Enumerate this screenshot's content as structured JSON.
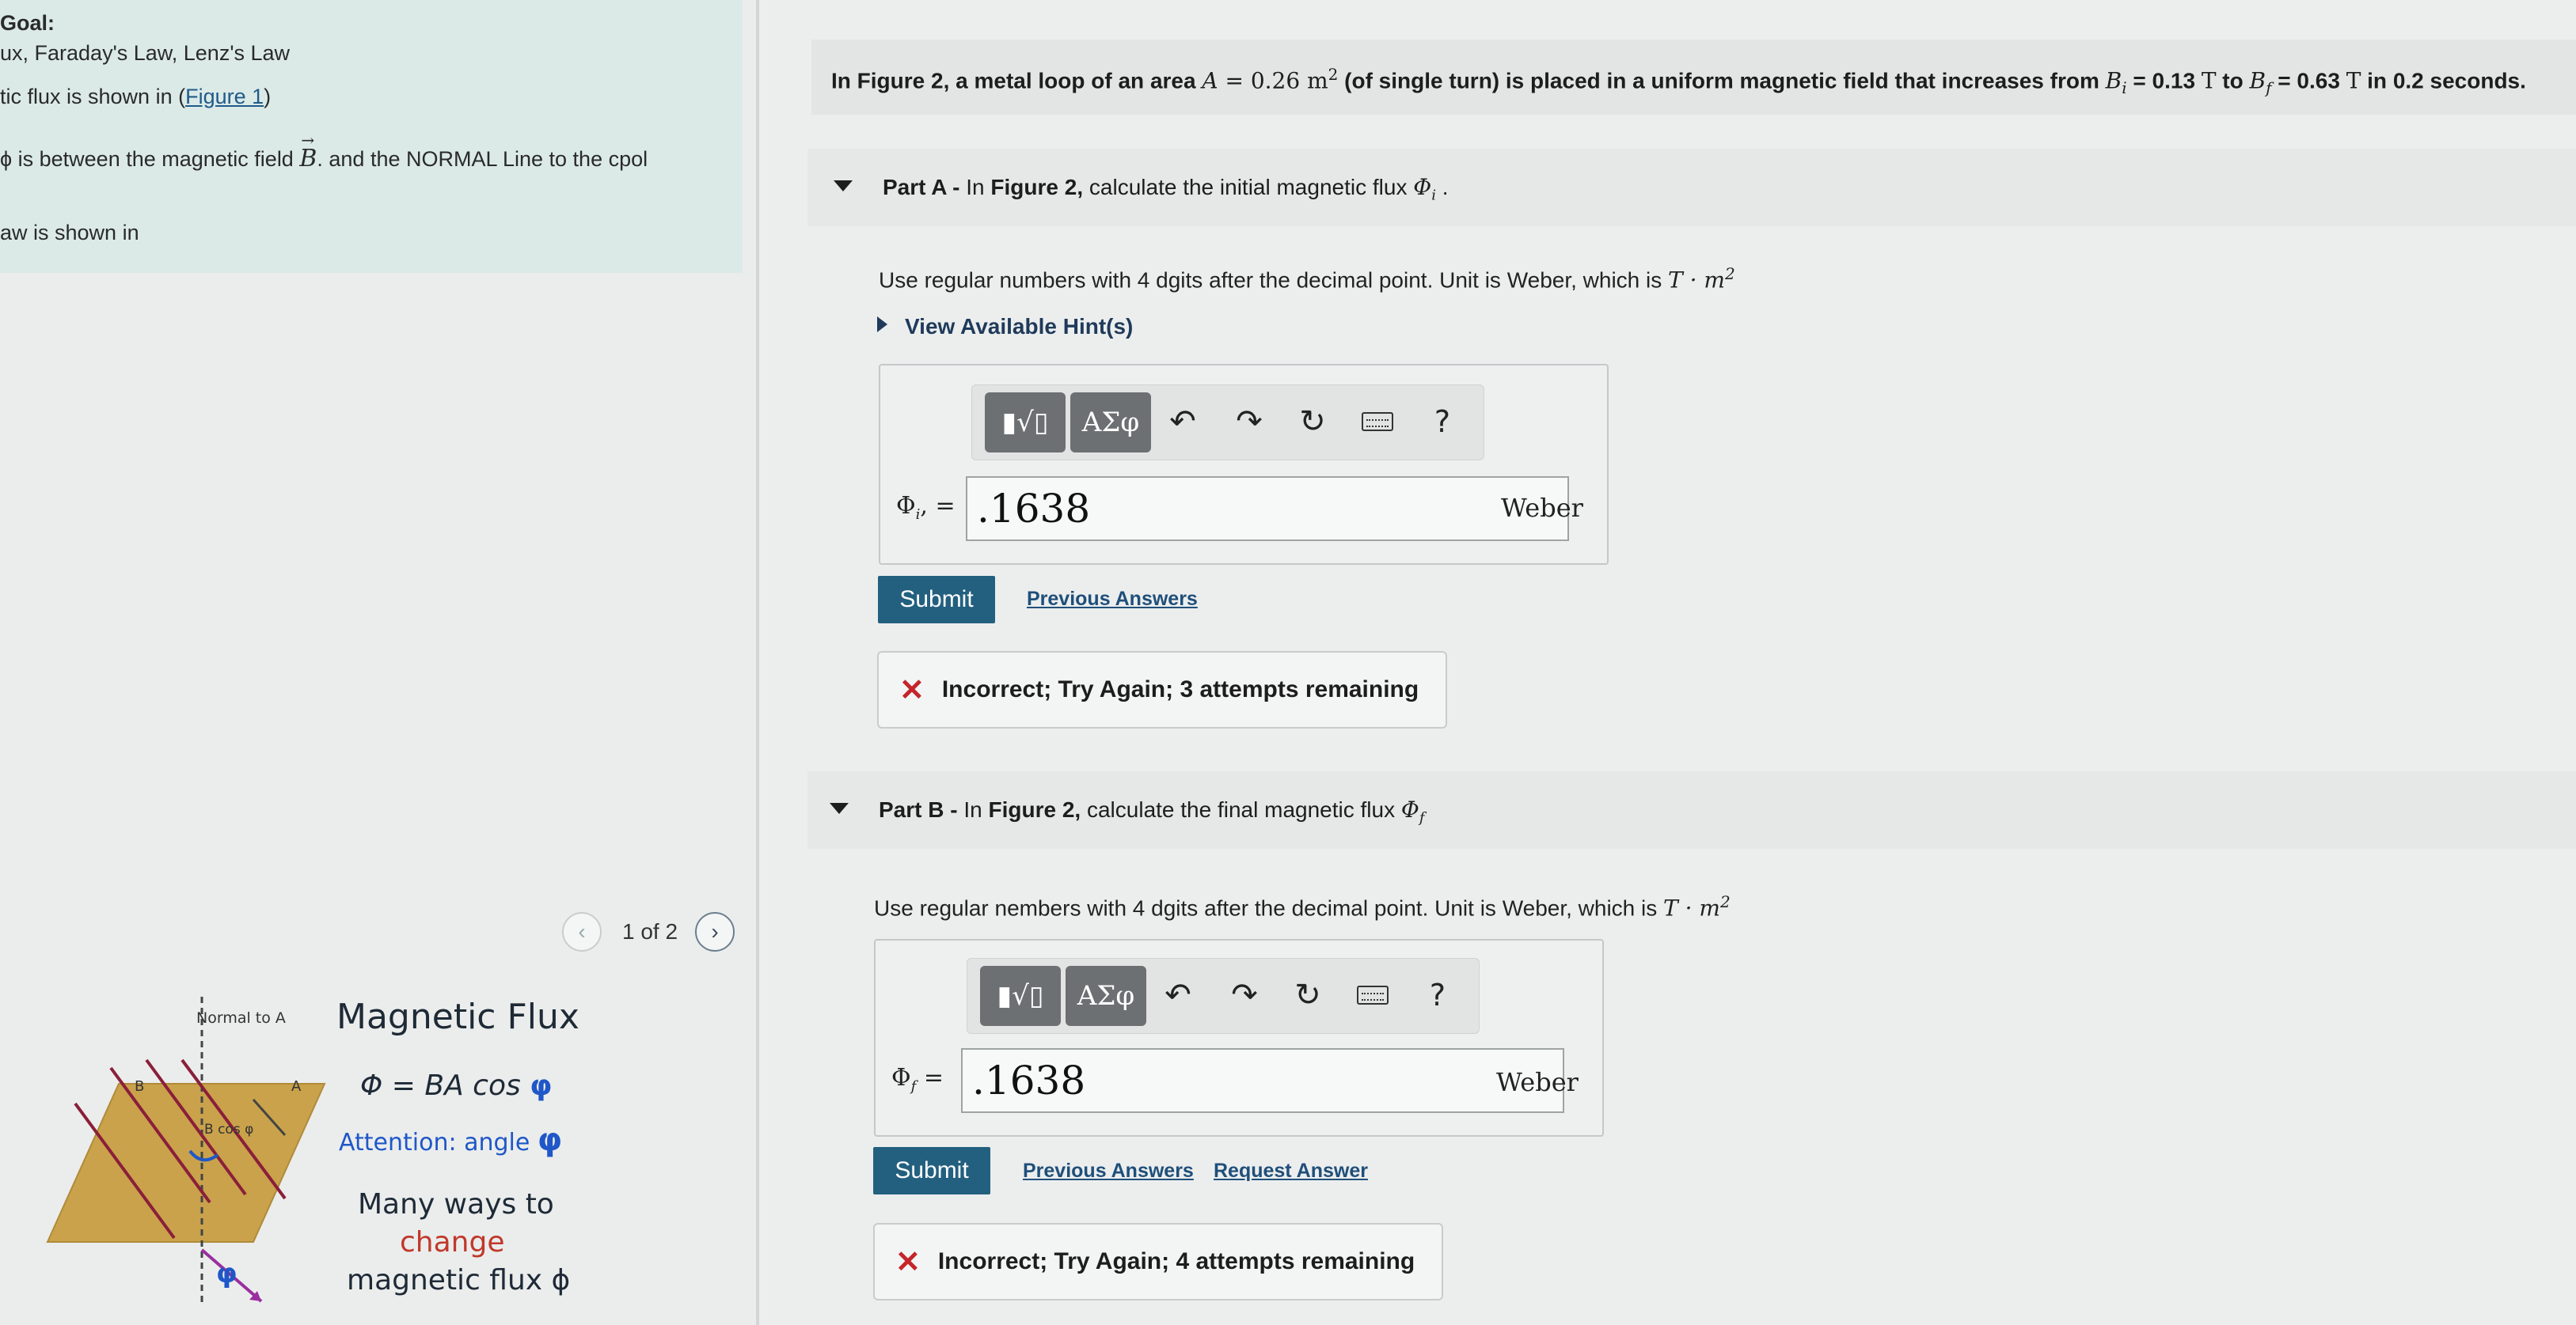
{
  "goal": {
    "heading": "Goal:",
    "line1": "ux, Faraday's Law, Lenz's Law",
    "line2_prefix": "tic flux is shown in (",
    "line2_link": "Figure 1",
    "line2_suffix": ")",
    "line3_prefix": "ϕ is between the magnetic field ",
    "line3_symbol": "B",
    "line3_suffix": ". and the NORMAL Line to the cpol",
    "line4": "aw is shown in"
  },
  "pager": {
    "label": "1 of 2",
    "prev_icon": "chevron-left-icon",
    "next_icon": "chevron-right-icon"
  },
  "figure": {
    "normal_label": "Normal to A",
    "b_label": "B",
    "a_label": "A",
    "bcos_label": "B cos φ",
    "phi_label": "φ",
    "title": "Magnetic Flux",
    "formula": "Φ = BA cos",
    "formula_phi": "φ",
    "attention": "Attention: angle",
    "attention_phi": "φ",
    "many1": "Many ways to",
    "many2": "change",
    "many3": "magnetic flux ϕ"
  },
  "question": {
    "intro": "In Figure 2, a metal loop of an area ",
    "area_sym": "A",
    "area_val": " = 0.26 m",
    "area_sup": "2",
    "mid": " (of single turn) is placed in a uniform magnetic field that  increases from ",
    "bi_sym": "B",
    "bi_sub": "i",
    "bi_val": " = 0.13 ",
    "t1": "T",
    "to": " to ",
    "bf_sym": "B",
    "bf_sub": "f",
    "bf_val": " = 0.63 ",
    "t2": "T",
    "end": " in 0.2 seconds."
  },
  "partA": {
    "label": "Part A - ",
    "prefix": "In ",
    "fig": "Figure 2,",
    "rest": " calculate the initial magnetic flux ",
    "symbol": "Φ",
    "sub": "i",
    "tail": " .",
    "instructions": "Use regular numbers with 4 dgits after the decimal point. Unit is Weber, which is ",
    "unit_math": "T · m",
    "unit_sup": "2",
    "hint": "View Available Hint(s)",
    "field_label": "Φ",
    "field_sub": "i",
    "field_eq": ", =",
    "value": ".1638",
    "unit": "Weber",
    "submit": "Submit",
    "previous": "Previous Answers",
    "feedback": "Incorrect; Try Again; 3 attempts remaining"
  },
  "partB": {
    "label": "Part B - ",
    "prefix": "In ",
    "fig": "Figure 2,",
    "rest": " calculate the final magnetic flux ",
    "symbol": "Φ",
    "sub": "f",
    "instructions": "Use regular nembers with 4 dgits after the decimal point. Unit is Weber, which is ",
    "unit_math": "T · m",
    "unit_sup": "2",
    "field_label": "Φ",
    "field_sub": "f",
    "field_eq": " =",
    "value": ".1638",
    "unit": "Weber",
    "submit": "Submit",
    "previous": "Previous Answers",
    "request": "Request Answer",
    "feedback": "Incorrect; Try Again; 4 attempts remaining"
  },
  "toolbar": {
    "templates_label": "▮√▯",
    "greek_label": "ΑΣφ",
    "help_label": "?",
    "undo_icon": "undo-icon",
    "redo_icon": "redo-icon",
    "reset_icon": "reset-icon",
    "keyboard_icon": "keyboard-icon"
  },
  "colors": {
    "goal_panel": "#dbeae7",
    "submit": "#23607f",
    "error_x": "#c4252a",
    "phi_blue": "#1f57c8",
    "change_red": "#c0392b"
  }
}
